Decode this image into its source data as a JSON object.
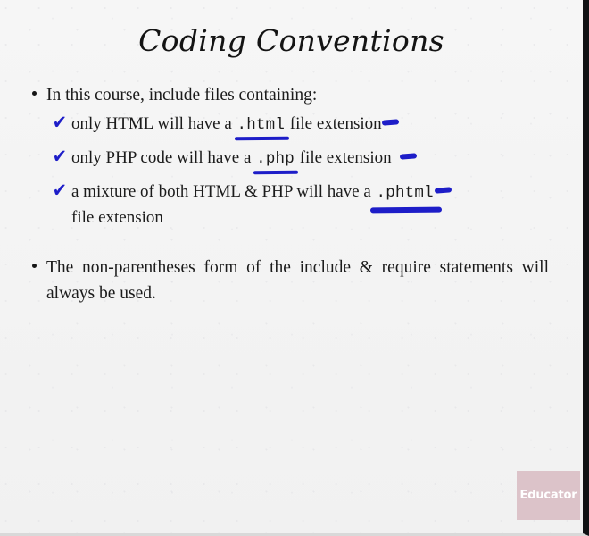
{
  "slide": {
    "title": "Coding Conventions",
    "background_color": "#f3f3f3",
    "text_color": "#1b1b1b",
    "annotation_color": "#1d1dc8"
  },
  "bullets": [
    {
      "marker": "bullet-dot",
      "text": "In this course, include files containing:"
    },
    {
      "marker": "bullet-dot",
      "text": "The non-parentheses form of the include & require statements will always be used."
    }
  ],
  "checklist": [
    {
      "marker": "check-mark",
      "mark_glyph": "✔",
      "before": "only HTML will have a ",
      "code": ".html",
      "after": " file extension",
      "trailing_dash": true,
      "wrap_line": ""
    },
    {
      "marker": "check-mark",
      "mark_glyph": "✔",
      "before": "only PHP code will have a ",
      "code": ".php",
      "after": " file extension",
      "trailing_dash": true,
      "wrap_line": ""
    },
    {
      "marker": "check-mark",
      "mark_glyph": "✔",
      "before": "a mixture of both HTML & PHP will have a ",
      "code": ".phtml",
      "after": "",
      "trailing_dash": true,
      "wrap_line": "file extension"
    }
  ],
  "logo": {
    "text": "Educator",
    "background_color": "#dcc3c9",
    "text_color": "#ffffff"
  }
}
